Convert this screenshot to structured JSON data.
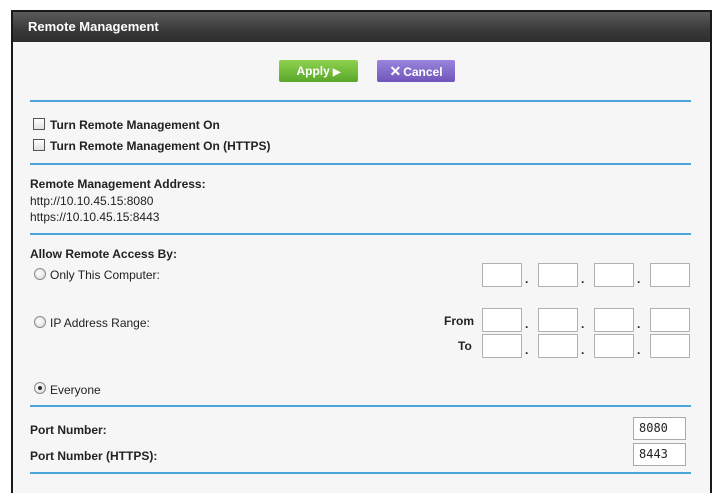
{
  "header": {
    "title": "Remote Management"
  },
  "actions": {
    "apply_label": "Apply",
    "apply_icon": "triangle-right-icon",
    "cancel_label": "Cancel",
    "cancel_icon": "x-icon"
  },
  "options": {
    "turn_on": {
      "label": "Turn Remote Management On",
      "checked": false
    },
    "turn_on_https": {
      "label": "Turn Remote Management On (HTTPS)",
      "checked": false
    }
  },
  "address": {
    "heading": "Remote Management Address:",
    "http": "http://10.10.45.15:8080",
    "https": "https://10.10.45.15:8443"
  },
  "access": {
    "heading": "Allow Remote Access By:",
    "only_this_computer": "Only This Computer:",
    "ip_range": "IP Address Range:",
    "from_label": "From",
    "to_label": "To",
    "dot": ".",
    "everyone": "Everyone",
    "selected": "Everyone"
  },
  "ports": {
    "port_label": "Port Number:",
    "port_value": "8080",
    "https_label": "Port Number (HTTPS):",
    "https_value": "8443"
  },
  "colors": {
    "rule": "#4aa6d6",
    "apply": "#6fbd3a",
    "cancel": "#7f68c9",
    "title_bg": "#3a3a3a"
  }
}
